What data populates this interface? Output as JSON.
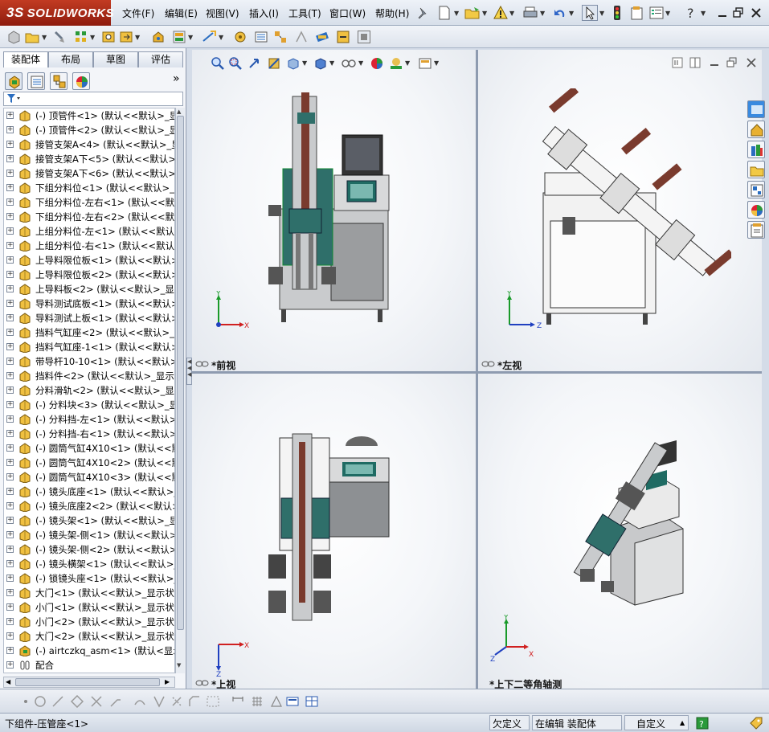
{
  "app": {
    "brand": "SOLIDWORKS",
    "brand_prefix": "3S"
  },
  "menu": [
    "文件(F)",
    "编辑(E)",
    "视图(V)",
    "插入(I)",
    "工具(T)",
    "窗口(W)",
    "帮助(H)"
  ],
  "left_panel": {
    "tabs": [
      "装配体",
      "布局",
      "草图",
      "评估"
    ],
    "active_tab": "装配体",
    "expand_arrow": "»",
    "tree_items": [
      "(-) 顶管件<1> (默认<<默认>_显示",
      "(-) 顶管件<2> (默认<<默认>_显示",
      "接管支架A<4> (默认<<默认>_显",
      "接管支架A下<5> (默认<<默认>_",
      "接管支架A下<6> (默认<<默认>_",
      "下组分料位<1> (默认<<默认>_显",
      "下组分料位-左右<1> (默认<<默认",
      "下组分料位-左右<2> (默认<<默认",
      "上组分料位-左<1> (默认<<默认>_",
      "上组分料位-右<1> (默认<<默认>_",
      "上导料限位板<1> (默认<<默认>",
      "上导料限位板<2> (默认<<默认>",
      "上导料板<2> (默认<<默认>_显示",
      "导料测试底板<1> (默认<<默认>",
      "导料测试上板<1> (默认<<默认>",
      "挡料气缸座<2> (默认<<默认>_显",
      "挡料气缸座-1<1> (默认<<默认>_",
      "带导杆10-10<1> (默认<<默认>_",
      "挡料件<2> (默认<<默认>_显示状",
      "分料滑轨<2> (默认<<默认>_显示",
      "(-) 分料块<3> (默认<<默认>_显",
      "(-) 分料挡-左<1> (默认<<默认>_",
      "(-) 分料挡-右<1> (默认<<默认>_",
      "(-) 圆筒气缸4X10<1> (默认<<默认",
      "(-) 圆筒气缸4X10<2> (默认<<默认",
      "(-) 圆筒气缸4X10<3> (默认<<默认",
      "(-) 镜头底座<1> (默认<<默认>_显",
      "(-) 镜头底座2<2> (默认<<默认>_",
      "(-) 镜头架<1> (默认<<默认>_显示",
      "(-) 镜头架-侧<1> (默认<<默认>_",
      "(-) 镜头架-侧<2> (默认<<默认>_",
      "(-) 镜头横架<1> (默认<<默认>_显",
      "(-) 锁镜头座<1> (默认<<默认>_显",
      "大门<1> (默认<<默认>_显示状态",
      "小门<1> (默认<<默认>_显示状态",
      "小门<2> (默认<<默认>_显示状态",
      "大门<2> (默认<<默认>_显示状态",
      "(-) airtczkq_asm<1> (默认<显示状",
      "配合"
    ]
  },
  "viewports": [
    {
      "label": "*前视"
    },
    {
      "label": "*左视"
    },
    {
      "label": "*上视"
    },
    {
      "label": "*上下二等角轴测"
    }
  ],
  "axis": {
    "x": "X",
    "y": "Y",
    "z": "Z"
  },
  "status_bar": {
    "left_text": "下组件-压管座<1>",
    "under_defined": "欠定义",
    "editing": "在编辑 装配体",
    "custom": "自定义"
  },
  "colors": {
    "brand_red": "#b0301a",
    "machine_teal": "#2f6f6a",
    "machine_gray": "#8a8d91",
    "accent_brown": "#7a3b2e",
    "axis_red": "#d02020",
    "axis_green": "#1a9a2a",
    "axis_blue": "#2040c0"
  }
}
